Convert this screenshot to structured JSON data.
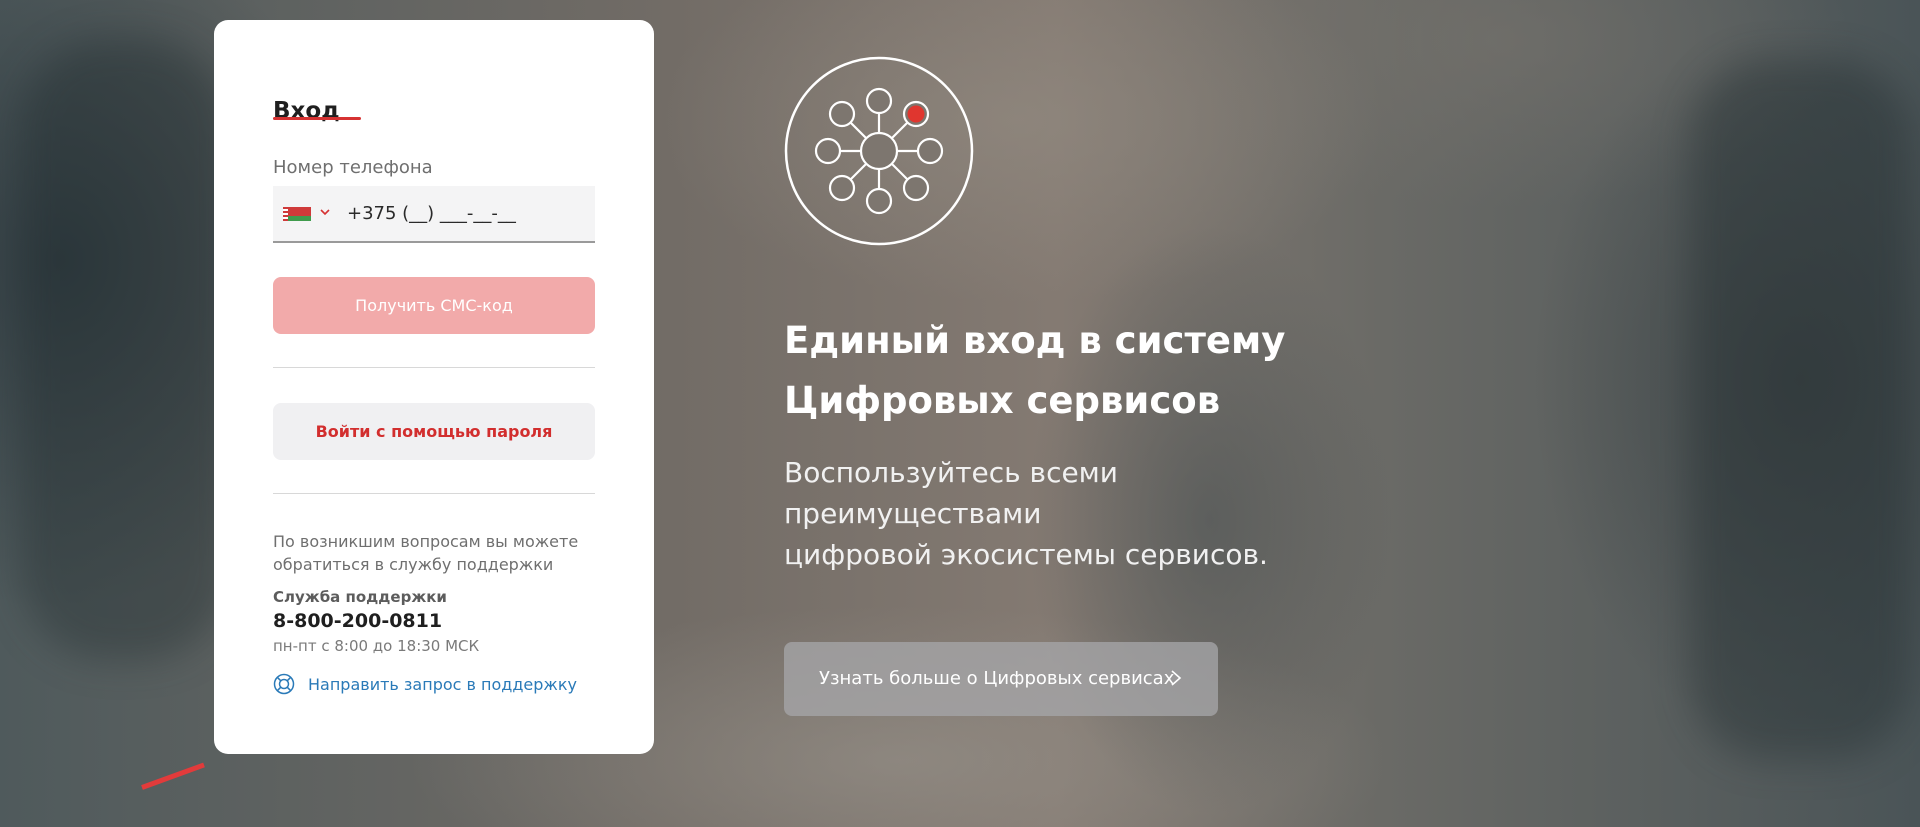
{
  "login": {
    "tab_title": "Вход",
    "phone_label": "Номер телефона",
    "phone_value": "+375 (__) ___-__-__",
    "country_flag": "belarus-flag-icon",
    "sms_button": "Получить СМС-код",
    "password_button": "Войти с помощью пароля",
    "help_text": "По возникшим вопросам вы можете обратиться в службу поддержки",
    "support_title": "Служба поддержки",
    "support_phone": "8-800-200-0811",
    "support_hours": "пн-пт с 8:00 до 18:30 МСК",
    "support_link": "Направить запрос в поддержку",
    "support_link_icon": "lifebuoy-icon"
  },
  "promo": {
    "icon": "network-hub-icon",
    "headline_line1": "Единый вход в систему",
    "headline_line2": "Цифровых сервисов",
    "subtext_line1": "Воспользуйтесь всеми",
    "subtext_line2": "преимуществами",
    "subtext_line3": "цифровой экосистемы сервисов.",
    "more_button": "Узнать больше о Цифровых сервисах",
    "more_button_icon": "chevron-right-icon"
  },
  "colors": {
    "accent_red": "#d63232",
    "disabled_button": "#f2aaaa",
    "link_blue": "#2a7ab8"
  }
}
